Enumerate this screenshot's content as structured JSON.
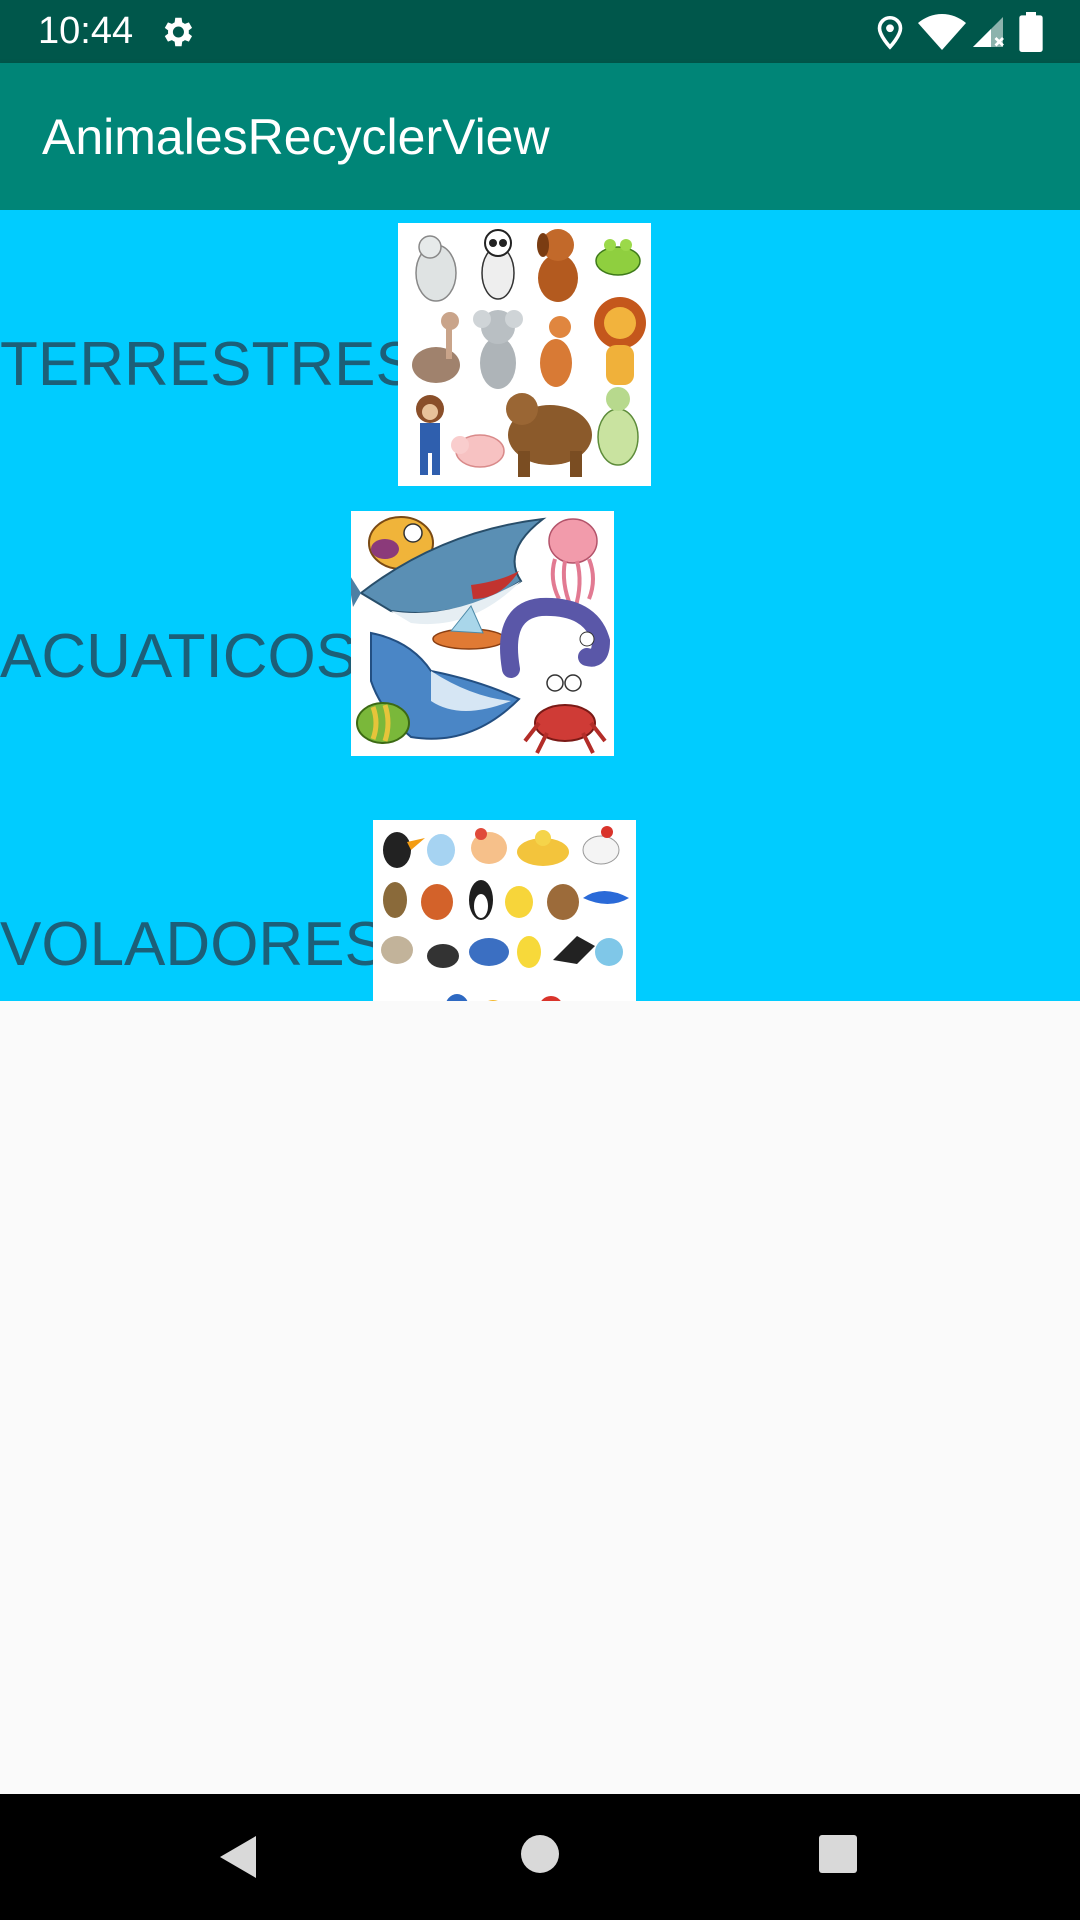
{
  "status_bar": {
    "time": "10:44",
    "icons": [
      "gear-icon",
      "location-icon",
      "wifi-icon",
      "cell-signal-icon",
      "battery-icon"
    ]
  },
  "app_bar": {
    "title": "AnimalesRecyclerView",
    "color": "#008577"
  },
  "list": {
    "background": "#00ccff",
    "items": [
      {
        "label": "TERRESTRES",
        "image": "land-animals-image"
      },
      {
        "label": "ACUATICOS",
        "image": "sea-animals-image"
      },
      {
        "label": "VOLADORES",
        "image": "birds-image"
      }
    ]
  },
  "nav_bar": {
    "icons": [
      "back-icon",
      "home-icon",
      "recents-icon"
    ]
  }
}
